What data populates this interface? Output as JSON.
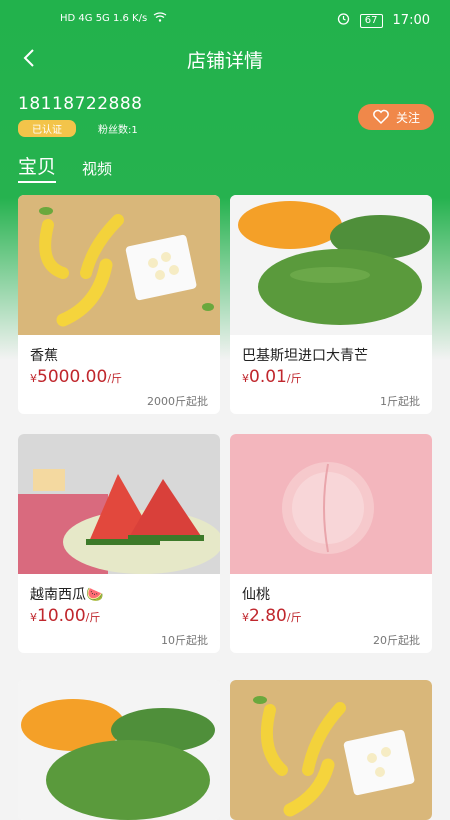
{
  "status": {
    "left_info": "HD 4G 5G 1.6 K/s",
    "battery": "67",
    "time": "17:00"
  },
  "nav": {
    "title": "店铺详情"
  },
  "shop": {
    "name": "18118722888",
    "verified": "已认证",
    "fans": "粉丝数:1",
    "follow": "关注"
  },
  "tabs": {
    "active": "宝贝",
    "other": "视频"
  },
  "products": [
    {
      "name": "香蕉",
      "symbol": "¥",
      "price": "5000.00",
      "unit": "/斤",
      "moq": "2000斤起批"
    },
    {
      "name": "巴基斯坦进口大青芒",
      "symbol": "¥",
      "price": "0.01",
      "unit": "/斤",
      "moq": "1斤起批"
    },
    {
      "name": "越南西瓜🍉",
      "symbol": "¥",
      "price": "10.00",
      "unit": "/斤",
      "moq": "10斤起批"
    },
    {
      "name": "仙桃",
      "symbol": "¥",
      "price": "2.80",
      "unit": "/斤",
      "moq": "20斤起批"
    }
  ],
  "colors": {
    "brand_green": "#26b24f",
    "price_red": "#c0272d",
    "follow_orange": "#f0884a"
  }
}
